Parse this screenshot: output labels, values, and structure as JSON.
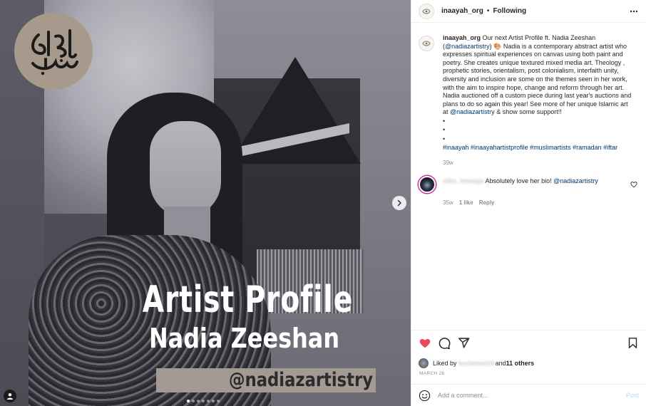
{
  "media": {
    "logo_glyph": "صنع الله",
    "title_line1": "Artist Profile",
    "title_line2": "Nadia Zeeshan",
    "handle_banner": "@nadiazartistry",
    "carousel_count": 7,
    "carousel_active": 1
  },
  "header": {
    "username": "inaayah_org",
    "separator": "•",
    "follow_state": "Following"
  },
  "caption": {
    "username": "inaayah_org",
    "text_1": " Our next Artist Profile ft. Nadia Zeeshan (",
    "mention_1": "@nadiazartistry",
    "text_2": ") ",
    "emoji": "🎨",
    "text_3": " Nadia is a contemporary abstract artist who expresses spiritual experiences on canvas using both paint and poetry. She creates unique textured mixed media art. Theology , prophetic stories, orientalism, post colonialism, interfaith unity, diversity and inclusion are some on the themes seen in her work, with the aim to inspire hope, change and reform through her art. Nadia auctioned off a custom piece during last year's auctions and plans to do so again this year! See more of her unique Islamic art at ",
    "mention_2": "@nadiazartistry",
    "text_4": " & show some support!!",
    "bullets": [
      "•",
      "•",
      "•"
    ],
    "hashtags": "#inaayah #inaayahartistprofile #muslimartists #ramadan #iftar",
    "age": "39w"
  },
  "comment": {
    "username": "niho_lovespa",
    "text": " Absolutely love her bio! ",
    "mention": "@nadiazartistry",
    "age": "35w",
    "likes": "1 like",
    "reply": "Reply"
  },
  "likes": {
    "prefix": "Liked by ",
    "user": "keziamarish",
    "middle": " and ",
    "others": "11 others"
  },
  "date": "MARCH 26",
  "add_comment": {
    "placeholder": "Add a comment...",
    "post_label": "Post"
  },
  "colors": {
    "heart": "#ed4956",
    "link": "#00376b",
    "muted": "#8e8e8e",
    "post_disabled": "#b2dffc",
    "logo_bg": "#a79a8d",
    "banner_bg": "#a39b93"
  }
}
